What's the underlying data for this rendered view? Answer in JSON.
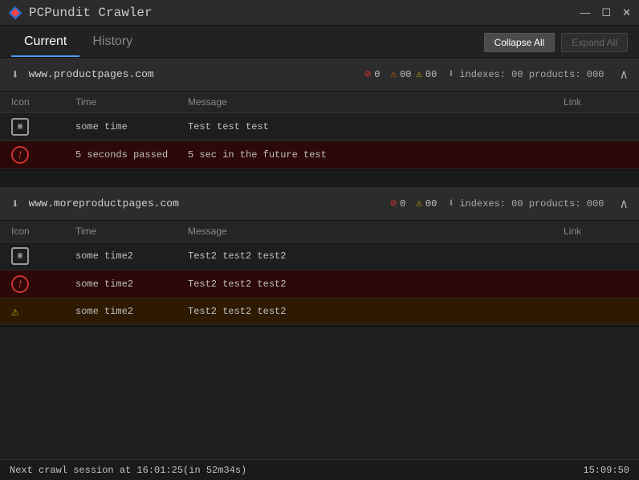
{
  "app": {
    "title": "PCPundit Crawler",
    "icon": "🔷"
  },
  "window_controls": {
    "minimize": "—",
    "maximize": "☐",
    "close": "✕"
  },
  "tabs": [
    {
      "label": "Current",
      "active": true
    },
    {
      "label": "History",
      "active": false
    }
  ],
  "toolbar": {
    "collapse_all_label": "Collapse All",
    "expand_all_label": "Expand All"
  },
  "sites": [
    {
      "url": "www.productpages.com",
      "badges": {
        "error_count": "0",
        "warning_count": "00",
        "alert_count": "00"
      },
      "stats": "indexes: 00  products: 000",
      "collapsed": false,
      "log_rows": [
        {
          "icon_type": "box",
          "time": "some time",
          "message": "Test test test",
          "link": "",
          "error": false
        },
        {
          "icon_type": "circle-exclaim",
          "time": "5 seconds passed",
          "message": "5 sec in the future test",
          "link": "",
          "error": true
        }
      ]
    },
    {
      "url": "www.moreproductpages.com",
      "badges": {
        "error_count": "0",
        "warning_count": "00",
        "alert_count": "00"
      },
      "stats": "indexes: 00  products: 000",
      "collapsed": false,
      "log_rows": [
        {
          "icon_type": "box",
          "time": "some time2",
          "message": "Test2 test2 test2",
          "link": "",
          "error": false
        },
        {
          "icon_type": "circle-exclaim",
          "time": "some time2",
          "message": "Test2 test2 test2",
          "link": "",
          "error": true
        },
        {
          "icon_type": "triangle-warn",
          "time": "some time2",
          "message": "Test2 test2 test2",
          "link": "",
          "error": false,
          "partial": true
        }
      ]
    }
  ],
  "status_bar": {
    "next_crawl": "Next crawl session at 16:01:25(in 52m34s)",
    "time": "15:09:50"
  },
  "table_headers": {
    "icon": "Icon",
    "time": "Time",
    "message": "Message",
    "link": "Link"
  }
}
